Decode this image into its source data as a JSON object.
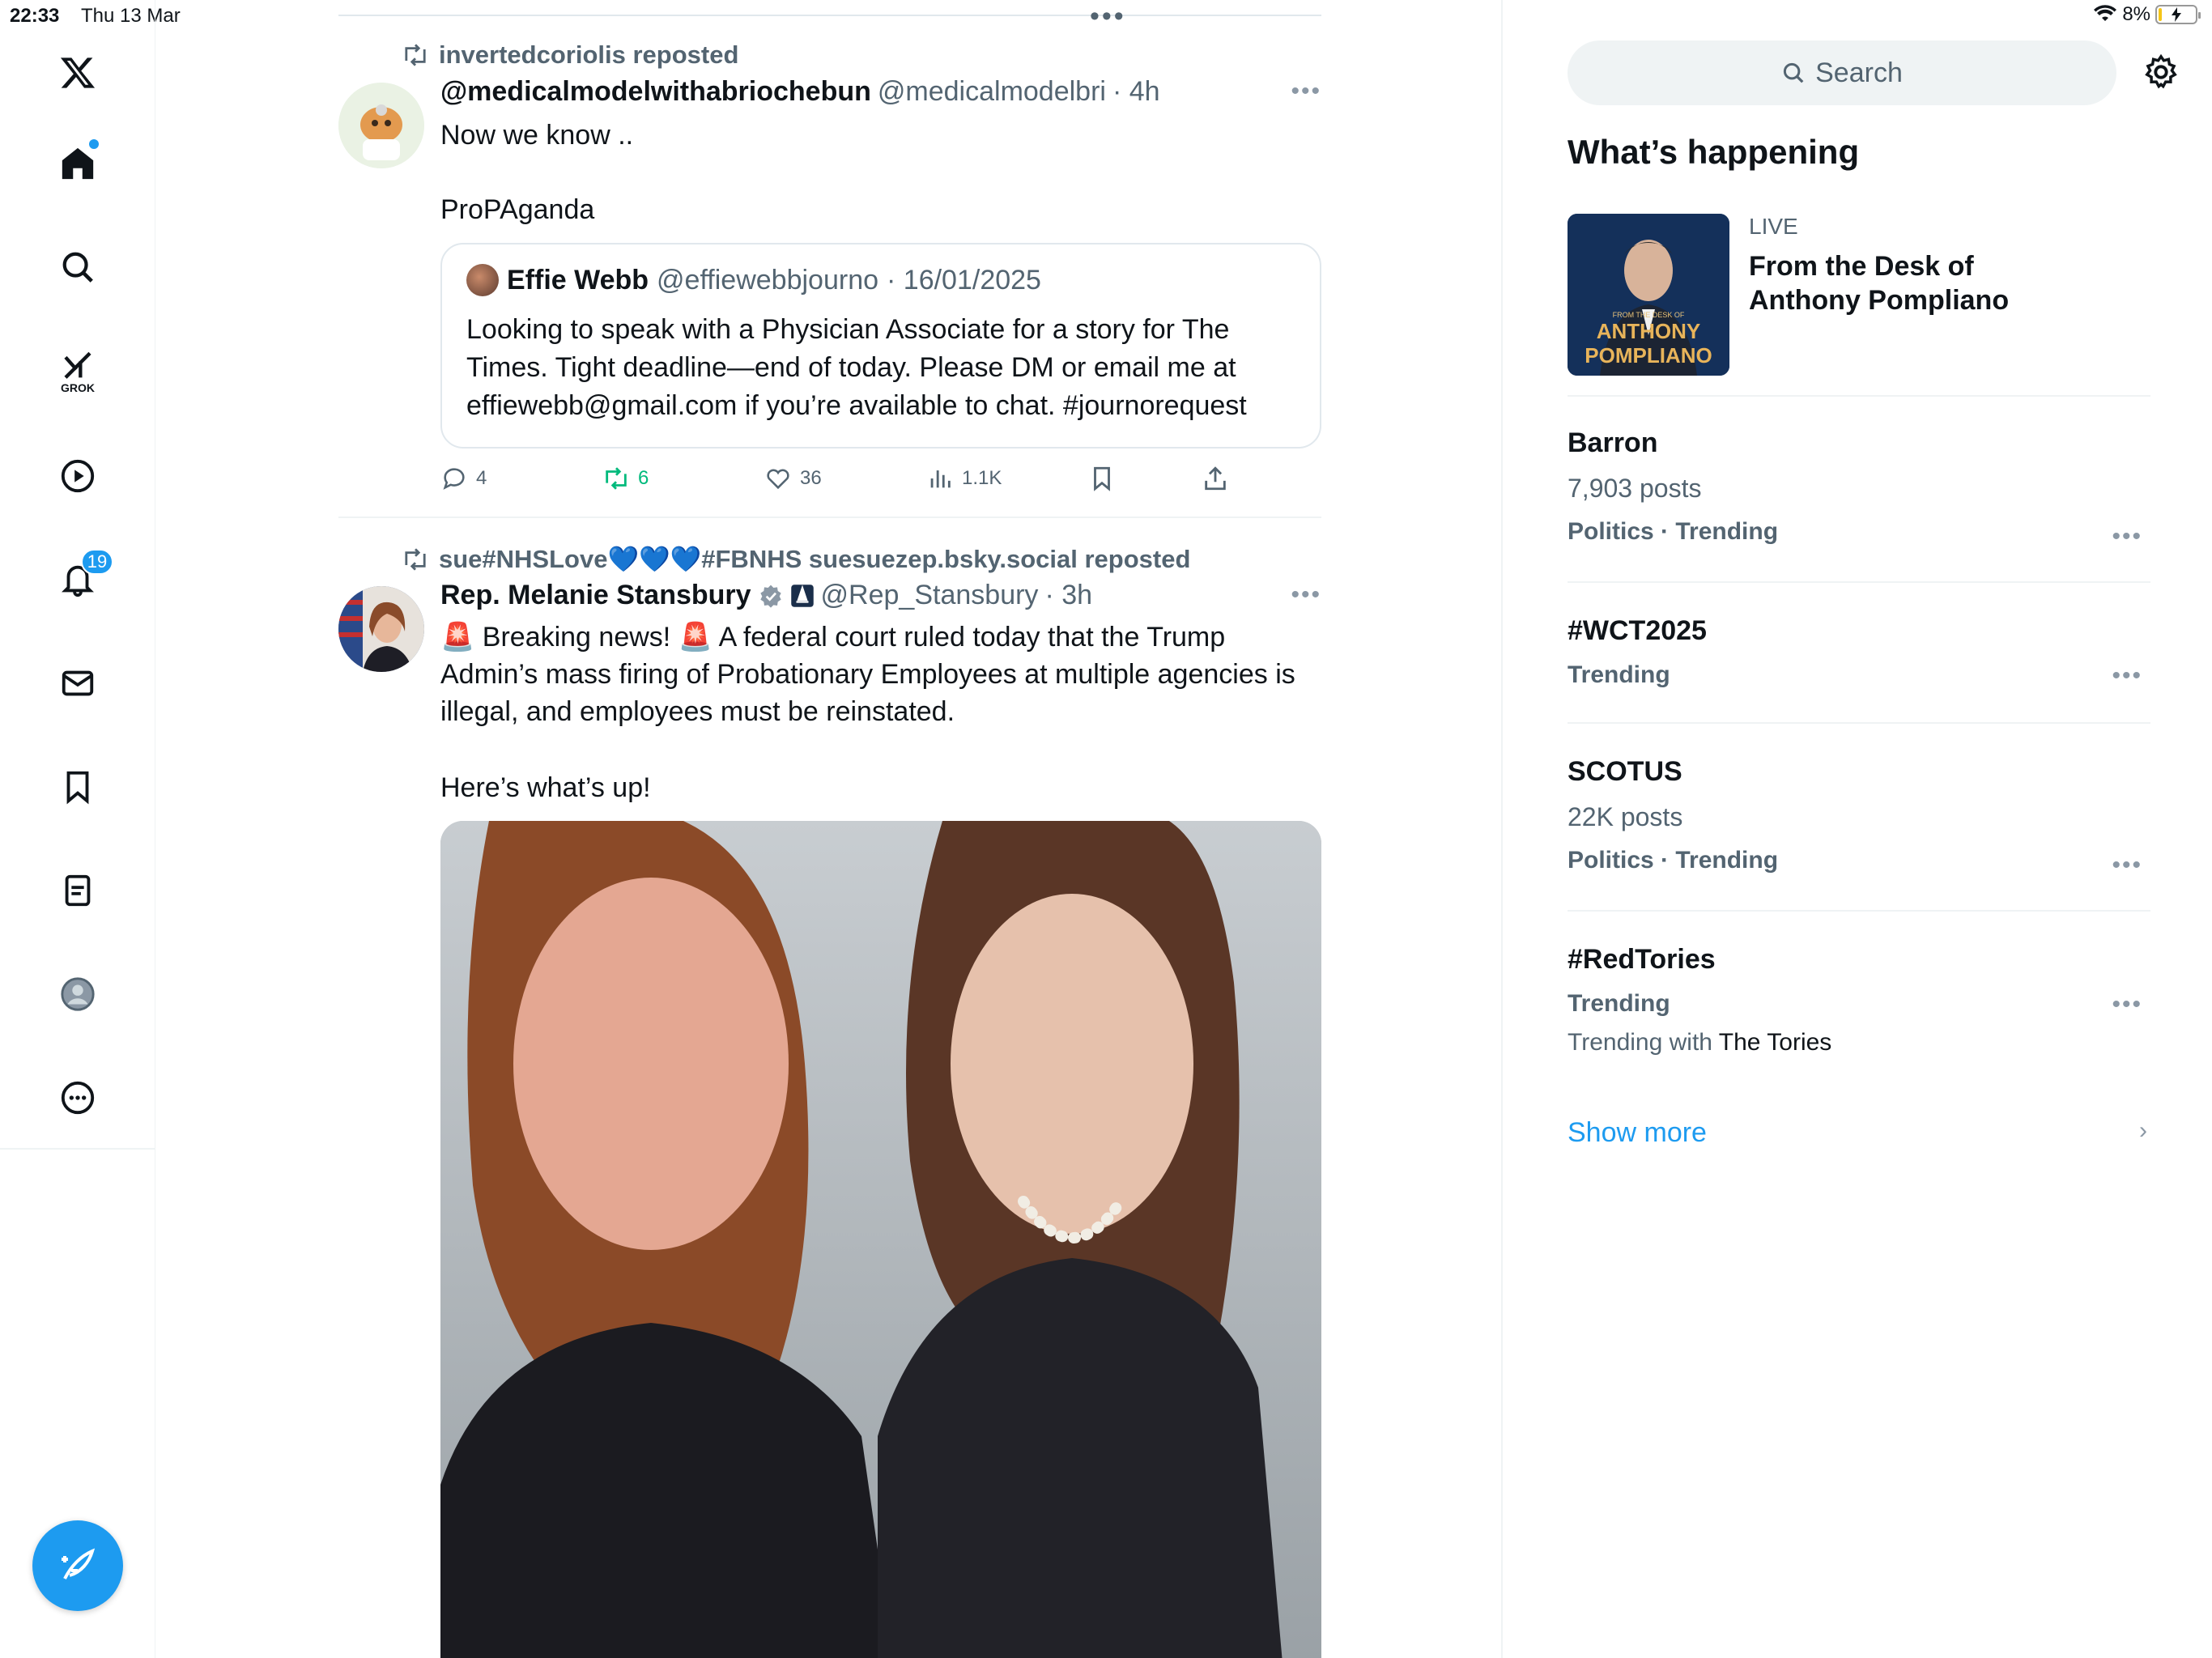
{
  "status_bar": {
    "time": "22:33",
    "date": "Thu 13 Mar",
    "battery": "8%",
    "battery_level": 0.08
  },
  "nav": {
    "grok_label": "GROK",
    "notifications_badge": "19"
  },
  "timeline": {
    "posts": [
      {
        "repost_by": "invertedcoriolis reposted",
        "name": "@medicalmodelwithabriochebun",
        "handle": "@medicalmodelbri",
        "time": "· 4h",
        "text_line1": "Now we know ..",
        "text_line2": "ProPAganda",
        "quote": {
          "name": "Effie Webb",
          "handle": "@effiewebbjourno",
          "date": "· 16/01/2025",
          "text": "Looking to speak with a Physician Associate for a story for The Times. Tight deadline—end of today. Please DM or email me at effiewebb@gmail.com if you’re available to chat. #journorequest"
        },
        "actions": {
          "replies": "4",
          "reposts": "6",
          "likes": "36",
          "views": "1.1K"
        }
      },
      {
        "repost_by": "sue#NHSLove💙💙💙#FBNHS suesuezep.bsky.social reposted",
        "name": "Rep. Melanie Stansbury",
        "handle": "@Rep_Stansbury",
        "time": "· 3h",
        "text": "🚨 Breaking news! 🚨 A federal court ruled today that the Trump Admin’s mass firing of Probationary Employees at multiple agencies is illegal, and employees must be reinstated.",
        "text_line2": "Here’s what’s up!"
      }
    ]
  },
  "sidebar": {
    "search_placeholder": "Search",
    "title": "What’s happening",
    "live": {
      "label": "LIVE",
      "title": "From the Desk of Anthony Pompliano",
      "thumb_small": "FROM THE DESK OF",
      "thumb_name1": "ANTHONY",
      "thumb_name2": "POMPLIANO"
    },
    "trends": [
      {
        "title": "Barron",
        "posts": "7,903 posts",
        "category": "Politics · Trending"
      },
      {
        "title": "#WCT2025",
        "category": "Trending"
      },
      {
        "title": "SCOTUS",
        "posts": "22K posts",
        "category": "Politics · Trending"
      },
      {
        "title": "#RedTories",
        "category": "Trending",
        "with_prefix": "Trending with",
        "with_name": "The Tories"
      }
    ],
    "show_more": "Show more"
  }
}
